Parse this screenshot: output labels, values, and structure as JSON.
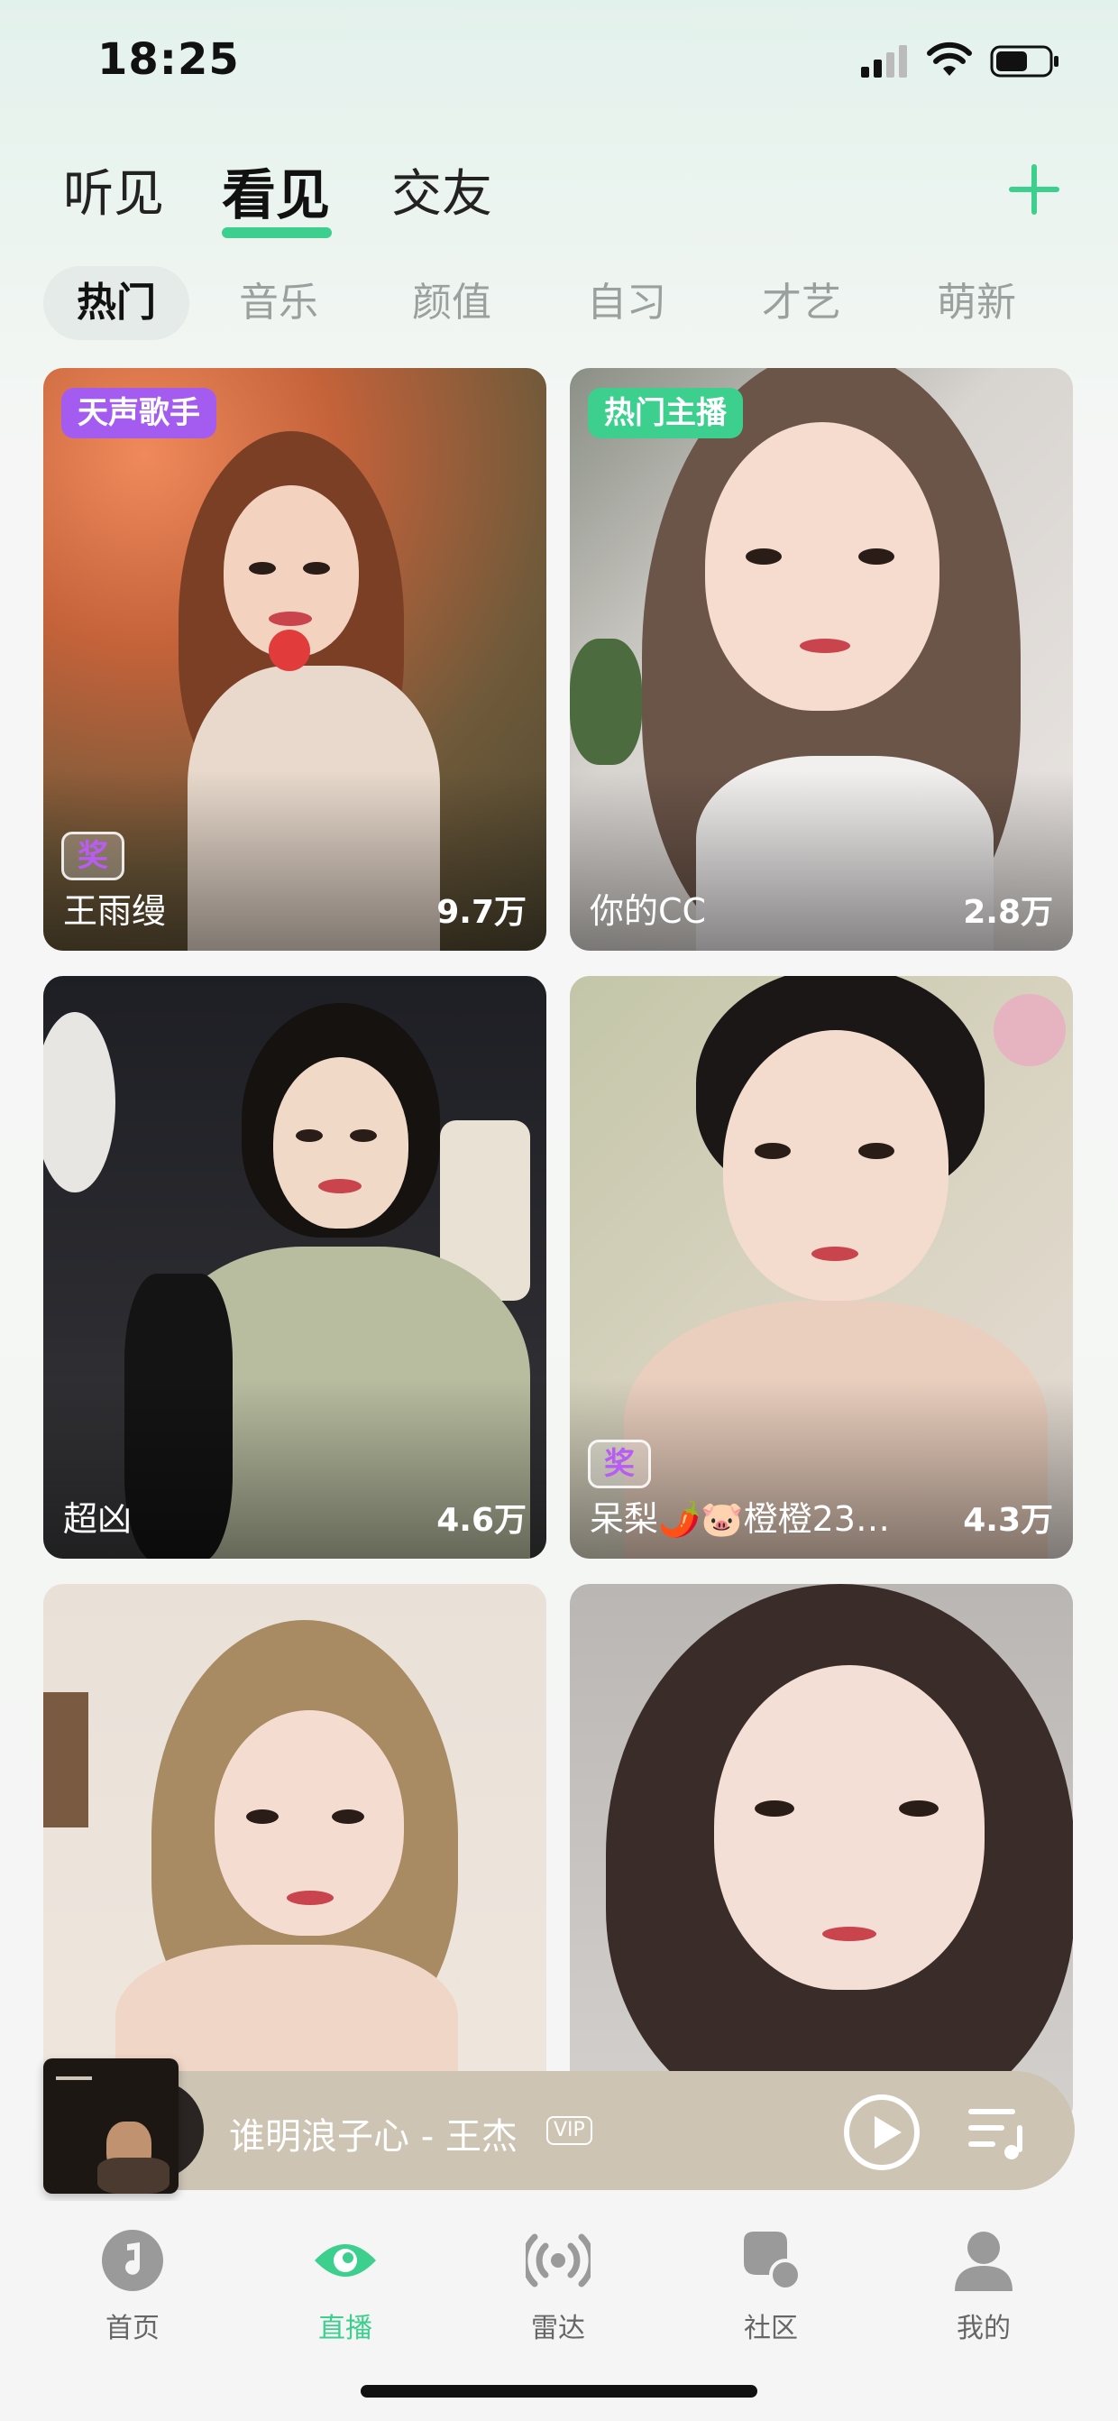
{
  "status_bar": {
    "time": "18:25"
  },
  "top_tabs": [
    "听见",
    "看见",
    "交友"
  ],
  "top_tab_active": "看见",
  "categories": [
    "热门",
    "音乐",
    "颜值",
    "自习",
    "才艺",
    "萌新"
  ],
  "category_active": "热门",
  "cards": [
    {
      "badge": "天声歌手",
      "badge_color": "#a45cf0",
      "star": true,
      "name": "王雨缦",
      "count": "9.7万"
    },
    {
      "badge": "热门主播",
      "badge_color": "#3ccf8e",
      "star": false,
      "name": "你的CC",
      "count": "2.8万"
    },
    {
      "badge": "",
      "star": false,
      "name": "超凶",
      "count": "4.6万"
    },
    {
      "badge": "",
      "star": true,
      "name": "呆梨🌶️🐷橙橙23…",
      "count": "4.3万"
    },
    {
      "badge": "",
      "star": false,
      "name": "",
      "count": ""
    },
    {
      "badge": "",
      "star": false,
      "name": "",
      "count": ""
    }
  ],
  "star_badge_text": "奖",
  "player": {
    "song": "谁明浪子心 - 王杰",
    "vip": "VIP"
  },
  "bottom_nav": [
    {
      "label": "首页",
      "icon": "music-note-icon"
    },
    {
      "label": "直播",
      "icon": "eye-icon"
    },
    {
      "label": "雷达",
      "icon": "radar-icon"
    },
    {
      "label": "社区",
      "icon": "community-icon"
    },
    {
      "label": "我的",
      "icon": "profile-icon"
    }
  ],
  "bottom_nav_active": "直播",
  "colors": {
    "accent": "#3ccf8e",
    "player_bg": "#cdc4b4",
    "purple_badge": "#a45cf0"
  }
}
